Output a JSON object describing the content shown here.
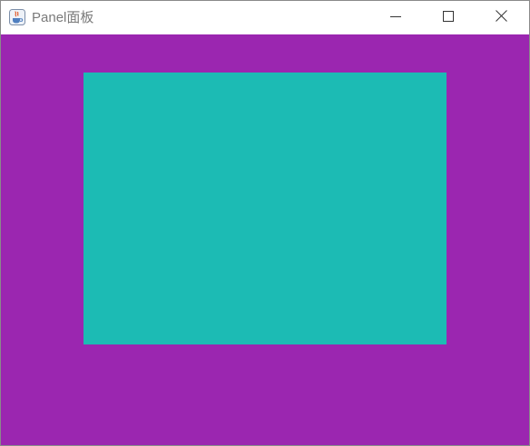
{
  "window": {
    "title": "Panel面板",
    "icons": {
      "app": "java-coffee-cup-icon",
      "minimize": "minimize-icon",
      "maximize": "maximize-icon",
      "close": "close-icon"
    }
  },
  "colors": {
    "frame_background": "#9b26b0",
    "panel_background": "#1cbbb4",
    "title_text": "#7a7a7a",
    "titlebar_background": "#ffffff"
  }
}
